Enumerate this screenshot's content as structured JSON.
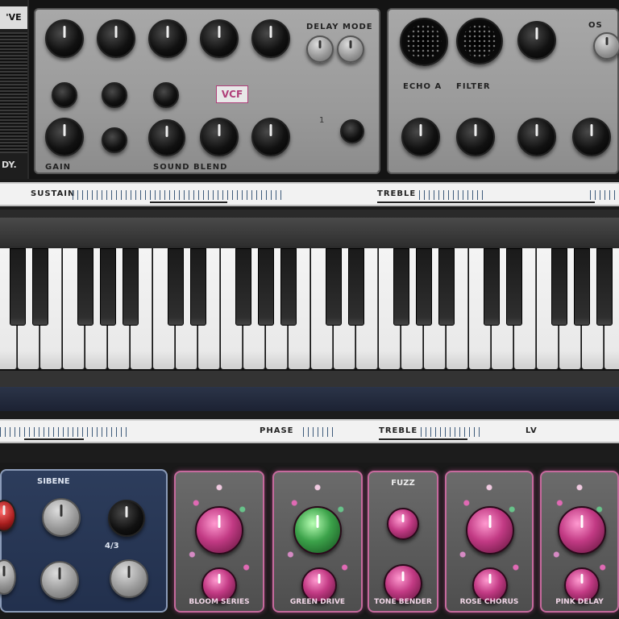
{
  "top_panel": {
    "speaker_badge": "'VE",
    "speaker_text": "DY.",
    "left_module": {
      "header_label": "DELAY MODE",
      "center_badge": "VCF",
      "bottom_left_label": "GAIN",
      "bottom_center_label": "SOUND BLEND",
      "tick_mark": "1"
    },
    "right_module": {
      "label_left": "ECHO A",
      "label_right": "FILTER",
      "header_label": "OS"
    }
  },
  "strip_top": {
    "left_text": "SUSTAIN",
    "mid_text": "TREBLE"
  },
  "strip_bottom": {
    "left_text": "PHASE",
    "mid_text": "TREBLE",
    "right_text": "LV"
  },
  "bottom_panel": {
    "blue_module": {
      "title": "SIBENE",
      "knob_label": "4/3"
    },
    "pedals": [
      {
        "label": "BLOOM SERIES",
        "top": ""
      },
      {
        "label": "GREEN DRIVE",
        "top": ""
      },
      {
        "label": "TONE BENDER",
        "top": "FUZZ"
      },
      {
        "label": "ROSE CHORUS",
        "top": ""
      },
      {
        "label": "PINK DELAY",
        "top": ""
      }
    ]
  },
  "colors": {
    "panel_grey": "#9a9a9a",
    "pedal_pink": "#c23a84",
    "pedal_green": "#3ca24a",
    "blue_module": "#2d3d5c"
  }
}
